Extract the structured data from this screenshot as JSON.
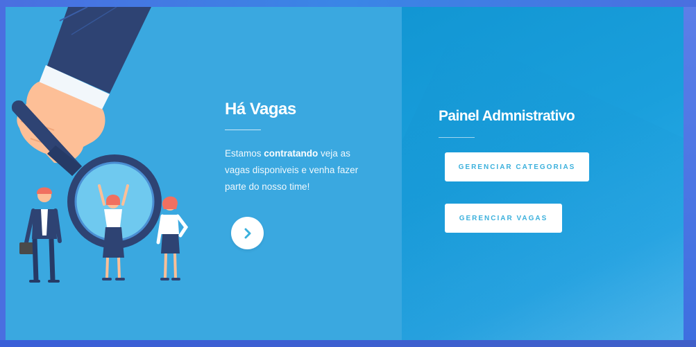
{
  "hiring": {
    "title": "Há Vagas",
    "text_before": "Estamos ",
    "text_bold": "contratando",
    "text_after": " veja as vagas disponiveis e venha fazer parte do nosso time!",
    "arrow_icon": "chevron-right-icon"
  },
  "admin": {
    "title": "Painel Admnistrativo",
    "buttons": {
      "categories_label": "GERENCIAR CATEGORIAS",
      "jobs_label": "GERENCIAR VAGAS"
    }
  },
  "colors": {
    "left_panel": "#3aa8e0",
    "right_panel": "#1a9fdc",
    "button_text": "#3bb0dc",
    "frame": "#4a6fe0"
  }
}
